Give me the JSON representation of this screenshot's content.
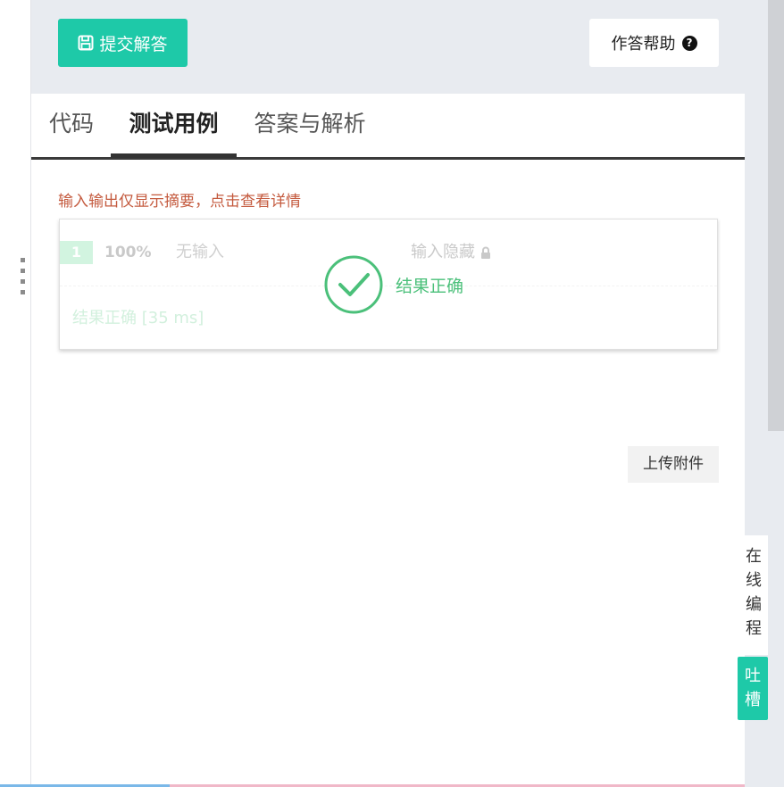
{
  "toolbar": {
    "submit_label": "提交解答",
    "submit_icon": "save-icon",
    "help_label": "作答帮助",
    "help_icon": "question-circle-icon"
  },
  "tabs": [
    {
      "label": "代码",
      "active": false
    },
    {
      "label": "测试用例",
      "active": true
    },
    {
      "label": "答案与解析",
      "active": false
    }
  ],
  "hint": "输入输出仅显示摘要，点击查看详情",
  "test_case": {
    "number": "1",
    "score": "100%",
    "input": "无输入",
    "hidden_label": "输入隐藏",
    "hidden_icon": "lock-icon",
    "result": "结果正确 [35 ms]",
    "overlay_text": "结果正确",
    "overlay_icon": "check-circle-icon"
  },
  "upload_label": "上传附件",
  "side": {
    "online_chars": [
      "在",
      "线",
      "编",
      "程"
    ],
    "feedback_chars": [
      "吐",
      "槽"
    ]
  },
  "colors": {
    "accent": "#1ec9a8",
    "success": "#4bc07a",
    "hint": "#c45a3e",
    "toolbar_bg": "#e8ebf0"
  }
}
